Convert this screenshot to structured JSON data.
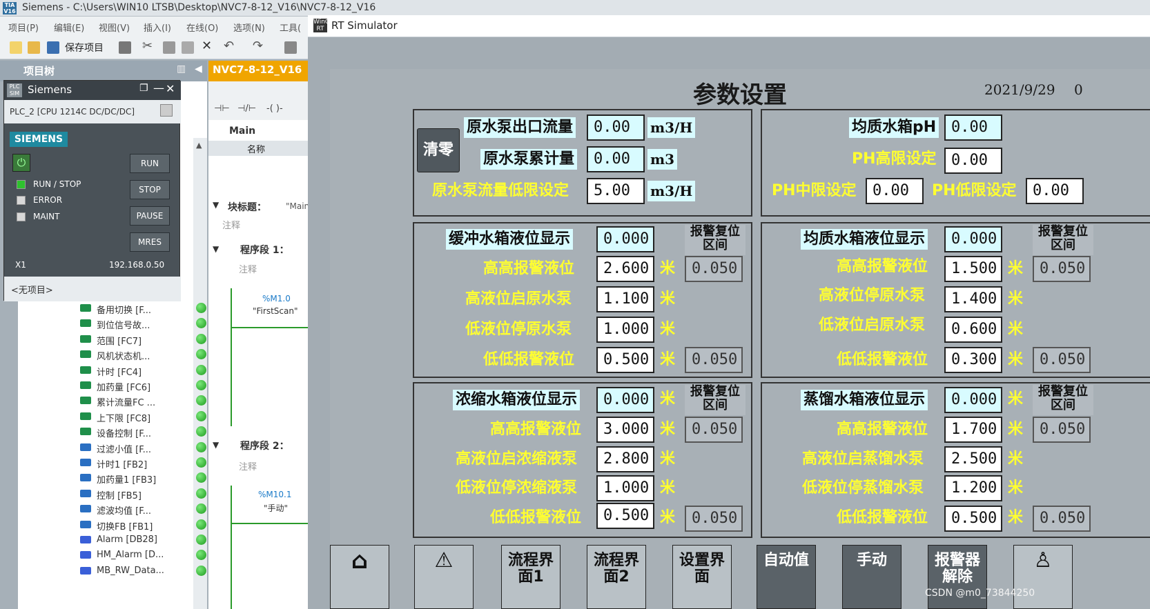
{
  "tia": {
    "title": "Siemens - C:\\Users\\WIN10 LTSB\\Desktop\\NVC7-8-12_V16\\NVC7-8-12_V16",
    "logo": "TIA V16",
    "menu": [
      "项目(P)",
      "编辑(E)",
      "视图(V)",
      "插入(I)",
      "在线(O)",
      "选项(N)",
      "工具("
    ],
    "save_label": "保存项目",
    "tree_header": "项目树",
    "program_tab": "NVC7-8-12_V16",
    "block_main": "Main",
    "col_name": "名称",
    "block_title": "块标题：",
    "block_title_value": "\"Main",
    "comment": "注释",
    "segment1": "程序段 1：",
    "segment2": "程序段 2：",
    "contact1_addr": "%M1.0",
    "contact1_name": "\"FirstScan\"",
    "contact2_addr": "%M10.1",
    "contact2_name": "\"手动\"",
    "tree_items": [
      {
        "label": "备用切换 [F...",
        "type": "fc"
      },
      {
        "label": "到位信号故...",
        "type": "fc"
      },
      {
        "label": "范围 [FC7]",
        "type": "fc"
      },
      {
        "label": "风机状态机...",
        "type": "fc"
      },
      {
        "label": "计时 [FC4]",
        "type": "fc"
      },
      {
        "label": "加药量 [FC6]",
        "type": "fc"
      },
      {
        "label": "累计流量FC ...",
        "type": "fc"
      },
      {
        "label": "上下限 [FC8]",
        "type": "fc"
      },
      {
        "label": "设备控制 [F...",
        "type": "fc"
      },
      {
        "label": "过滤小值 [F...",
        "type": "fb"
      },
      {
        "label": "计时1 [FB2]",
        "type": "fb"
      },
      {
        "label": "加药量1 [FB3]",
        "type": "fb"
      },
      {
        "label": "控制 [FB5]",
        "type": "fb"
      },
      {
        "label": "滤波均值 [F...",
        "type": "fb"
      },
      {
        "label": "切换FB [FB1]",
        "type": "fb"
      },
      {
        "label": "Alarm [DB28]",
        "type": "db"
      },
      {
        "label": "HM_Alarm [D...",
        "type": "db"
      },
      {
        "label": "MB_RW_Data...",
        "type": "db"
      }
    ]
  },
  "plcsim": {
    "title": "Siemens",
    "logo": "PLC SIM",
    "device": "PLC_2 [CPU 1214C DC/DC/DC]",
    "brand": "SIEMENS",
    "buttons": [
      "RUN",
      "STOP",
      "PAUSE",
      "MRES"
    ],
    "leds": [
      "RUN / STOP",
      "ERROR",
      "MAINT"
    ],
    "interface": "X1",
    "ip": "192.168.0.50",
    "project": "<无项目>"
  },
  "rt": {
    "title": "RT Simulator",
    "logo": "WinCC RT"
  },
  "hmi": {
    "title": "参数设置",
    "date": "2021/9/29",
    "time": "0",
    "clear": "清零",
    "raw": {
      "outlet_flow_label": "原水泵出口流量",
      "outlet_flow": "0.00",
      "outlet_flow_unit": "m3/H",
      "total_label": "原水泵累计量",
      "total": "0.00",
      "total_unit": "m3",
      "low_label": "原水泵流量低限设定",
      "low": "5.00",
      "low_unit": "m3/H"
    },
    "ph": {
      "ph_label": "均质水箱pH",
      "ph": "0.00",
      "high_label": "PH高限设定",
      "high": "0.00",
      "mid_label": "PH中限设定",
      "mid": "0.00",
      "low_label": "PH低限设定",
      "low": "0.00"
    },
    "reset_header": "报警复位区间",
    "unit_m": "米",
    "buffer": {
      "title": "缓冲水箱液位显示",
      "value": "0.000",
      "rows": [
        {
          "label": "高高报警液位",
          "value": "2.600",
          "reset": "0.050"
        },
        {
          "label": "高液位启原水泵",
          "value": "1.100"
        },
        {
          "label": "低液位停原水泵",
          "value": "1.000"
        },
        {
          "label": "低低报警液位",
          "value": "0.500",
          "reset": "0.050"
        }
      ]
    },
    "homog": {
      "title": "均质水箱液位显示",
      "value": "0.000",
      "rows": [
        {
          "label": "高高报警液位",
          "value": "1.500",
          "reset": "0.050"
        },
        {
          "label": "高液位停原水泵",
          "value": "1.400"
        },
        {
          "label": "低液位启原水泵",
          "value": "0.600"
        },
        {
          "label": "低低报警液位",
          "value": "0.300",
          "reset": "0.050"
        }
      ]
    },
    "conc": {
      "title": "浓缩水箱液位显示",
      "value": "0.000",
      "rows": [
        {
          "label": "高高报警液位",
          "value": "3.000",
          "reset": "0.050"
        },
        {
          "label": "高液位启浓缩液泵",
          "value": "2.800"
        },
        {
          "label": "低液位停浓缩液泵",
          "value": "1.000"
        },
        {
          "label": "低低报警液位",
          "value": "0.500",
          "reset": "0.050"
        }
      ]
    },
    "dist": {
      "title": "蒸馏水箱液位显示",
      "value": "0.000",
      "rows": [
        {
          "label": "高高报警液位",
          "value": "1.700",
          "reset": "0.050"
        },
        {
          "label": "高液位启蒸馏水泵",
          "value": "2.500"
        },
        {
          "label": "低液位停蒸馏水泵",
          "value": "1.200"
        },
        {
          "label": "低低报警液位",
          "value": "0.500",
          "reset": "0.050"
        }
      ]
    },
    "nav": [
      "流程界面1",
      "流程界面2",
      "设置界面",
      "自动值",
      "手动",
      "报警器解除"
    ],
    "watermark": "CSDN @m0_73844250"
  }
}
